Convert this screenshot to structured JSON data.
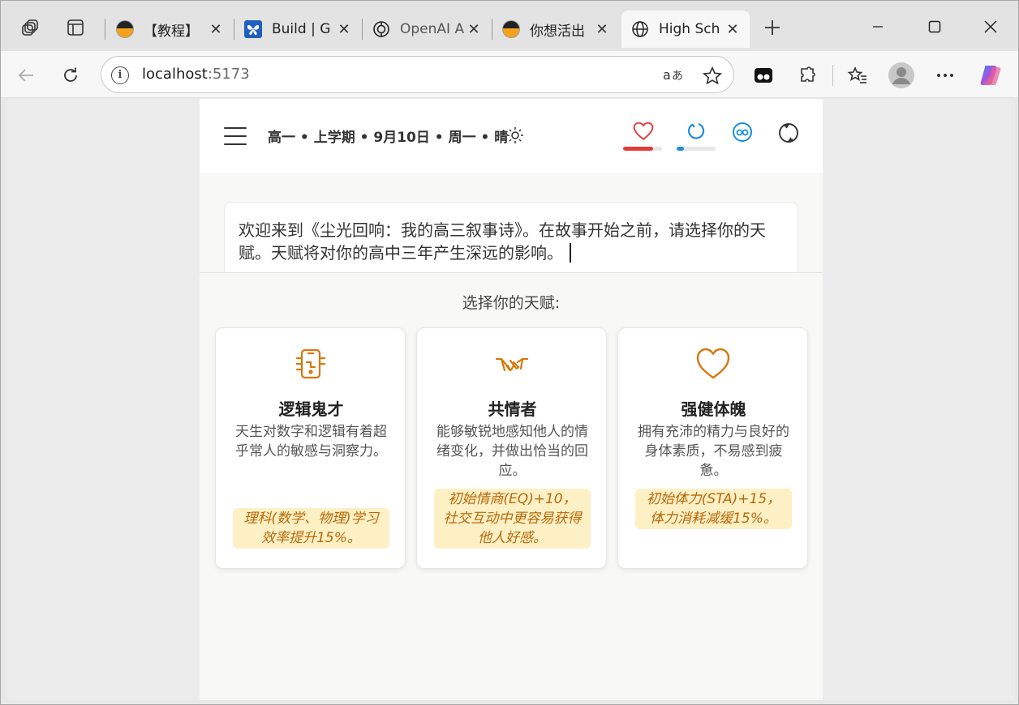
{
  "tabs": [
    {
      "title": "【教程】",
      "favicon": "split-circle-icon"
    },
    {
      "title": "Build | G",
      "favicon": "butterfly-icon"
    },
    {
      "title": "OpenAI A",
      "favicon": "openai-icon"
    },
    {
      "title": "你想活出",
      "favicon": "split-circle-icon"
    },
    {
      "title": "High Sch",
      "favicon": "globe-icon",
      "active": true
    }
  ],
  "address": {
    "host": "localhost",
    "port": ":5173"
  },
  "header": {
    "date_line": "高一 • 上学期 • 9月10日 • 周一 • 晴",
    "stats": [
      {
        "name": "health",
        "color": "#e23c3c",
        "level": 0.78
      },
      {
        "name": "energy",
        "color": "#1a8fd8",
        "level": 0.18
      },
      {
        "name": "social",
        "color": "#1a8fd8",
        "level": null
      },
      {
        "name": "mood",
        "color": "#333333",
        "level": null
      }
    ]
  },
  "story": {
    "text": "欢迎来到《尘光回响：我的高三叙事诗》。在故事开始之前，请选择你的天赋。天赋将对你的高中三年产生深远的影响。"
  },
  "choice": {
    "title": "选择你的天赋:",
    "cards": [
      {
        "icon": "phone-brain-icon",
        "name": "逻辑鬼才",
        "desc": "天生对数字和逻辑有着超乎常人的敏感与洞察力。",
        "effect": "理科(数学、物理)学习效率提升15%。"
      },
      {
        "icon": "handshake-icon",
        "name": "共情者",
        "desc": "能够敏锐地感知他人的情绪变化，并做出恰当的回应。",
        "effect": "初始情商(EQ)+10，社交互动中更容易获得他人好感。"
      },
      {
        "icon": "heart-icon",
        "name": "强健体魄",
        "desc": "拥有充沛的精力与良好的身体素质，不易感到疲惫。",
        "effect": "初始体力(STA)+15，体力消耗减缓15%。"
      }
    ],
    "accent": "#d9770a"
  }
}
